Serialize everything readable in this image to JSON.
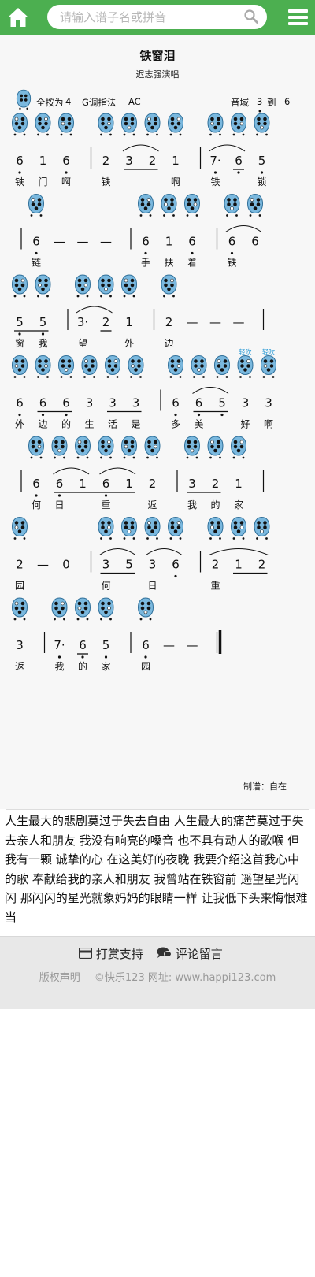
{
  "header": {
    "search_placeholder": "请输入谱子名或拼音",
    "accent_color": "#4caf50"
  },
  "song": {
    "title": "铁窗泪",
    "singer": "迟志强演唱",
    "fingering_prefix": "全按为",
    "fingering_note": "4",
    "fingering_method": "G调指法",
    "ocarina_type": "AC",
    "range_label": "音域",
    "range_low": "3",
    "range_to": "到",
    "range_high": "6",
    "maker": "制谱：自在"
  },
  "score_lines": [
    [
      {
        "n": "6",
        "lyr": "铁",
        "lo": 1,
        "oc": true
      },
      {
        "n": "1",
        "lyr": "门",
        "oc": true
      },
      {
        "n": "6",
        "lyr": "啊",
        "lo": 1,
        "oc": true
      },
      {
        "bar": true
      },
      {
        "n": "2",
        "lyr": "铁",
        "oc": true
      },
      {
        "n": "3",
        "ul": 1,
        "sl": "a",
        "oc": true
      },
      {
        "n": "2",
        "ul": 1,
        "sl": "a",
        "oc": true
      },
      {
        "n": "1",
        "lyr": "啊",
        "oc": true
      },
      {
        "bar": true
      },
      {
        "n": "7·",
        "lyr": "铁",
        "lo": 1,
        "sl": "b",
        "oc": true
      },
      {
        "n": "6",
        "ul": 1,
        "lo": 1,
        "sl": "b",
        "oc": true
      },
      {
        "n": "5",
        "lyr": "锁",
        "lo": 1,
        "oc": true
      }
    ],
    [
      {
        "bar": true
      },
      {
        "n": "6",
        "lyr": "链",
        "lo": 1,
        "oc": true
      },
      {
        "n": "—"
      },
      {
        "n": "—"
      },
      {
        "n": "—"
      },
      {
        "bar": true
      },
      {
        "n": "6",
        "lyr": "手",
        "lo": 1,
        "oc": true
      },
      {
        "n": "1",
        "lyr": "扶",
        "oc": true
      },
      {
        "n": "6",
        "lyr": "着",
        "lo": 1,
        "oc": true
      },
      {
        "bar": true
      },
      {
        "n": "6",
        "lyr": "铁",
        "lo": 1,
        "sl": "a",
        "oc": true
      },
      {
        "n": "6",
        "sl": "a",
        "oc": true
      }
    ],
    [
      {
        "n": "5",
        "ul": 1,
        "lyr": "窗",
        "lo": 1,
        "oc": true
      },
      {
        "n": "5",
        "ul": 1,
        "lyr": "我",
        "lo": 1,
        "oc": true
      },
      {
        "bar": true
      },
      {
        "n": "3·",
        "lyr": "望",
        "sl": "a",
        "oc": true
      },
      {
        "n": "2",
        "ul": 1,
        "sl": "a",
        "oc": true
      },
      {
        "n": "1",
        "lyr": "外",
        "oc": true
      },
      {
        "bar": true
      },
      {
        "n": "2",
        "lyr": "边",
        "oc": true
      },
      {
        "n": "—"
      },
      {
        "n": "—"
      },
      {
        "n": "—"
      },
      {
        "bar": true
      }
    ],
    [
      {
        "n": "6",
        "lyr": "外",
        "lo": 1,
        "oc": true
      },
      {
        "n": "6",
        "ul": 1,
        "lyr": "边",
        "lo": 1,
        "oc": true
      },
      {
        "n": "6",
        "ul": 1,
        "lyr": "的",
        "lo": 1,
        "oc": true
      },
      {
        "n": "3",
        "lyr": "生",
        "oc": true
      },
      {
        "n": "3",
        "ul": 1,
        "lyr": "活",
        "oc": true
      },
      {
        "n": "3",
        "ul": 1,
        "lyr": "是",
        "oc": true
      },
      {
        "bar": true
      },
      {
        "n": "6",
        "lyr": "多",
        "lo": 1,
        "oc": true
      },
      {
        "n": "6",
        "ul": 1,
        "lyr": "美",
        "lo": 1,
        "sl": "a",
        "oc": true
      },
      {
        "n": "5",
        "ul": 1,
        "lo": 1,
        "sl": "a",
        "oc": true
      },
      {
        "n": "3",
        "lyr": "好",
        "oc": true,
        "tag": "轻吹"
      },
      {
        "n": "3",
        "lyr": "啊",
        "oc": true,
        "tag": "轻吹"
      }
    ],
    [
      {
        "bar": true
      },
      {
        "n": "6",
        "lyr": "何",
        "lo": 1,
        "oc": true
      },
      {
        "n": "6",
        "ul": 1,
        "lyr": "日",
        "lo": 1,
        "sl": "a",
        "oc": true
      },
      {
        "n": "1",
        "ul": 1,
        "sl": "a",
        "oc": true
      },
      {
        "n": "6",
        "ul": 1,
        "lyr": "重",
        "lo": 1,
        "sl": "b",
        "oc": true
      },
      {
        "n": "1",
        "ul": 1,
        "sl": "b",
        "oc": true
      },
      {
        "n": "2",
        "lyr": "返",
        "oc": true
      },
      {
        "bar": true
      },
      {
        "n": "3",
        "ul": 1,
        "lyr": "我",
        "oc": true
      },
      {
        "n": "2",
        "ul": 1,
        "lyr": "的",
        "oc": true
      },
      {
        "n": "1",
        "lyr": "家",
        "oc": true
      },
      {
        "bar": true
      }
    ],
    [
      {
        "n": "2",
        "lyr": "园",
        "oc": true
      },
      {
        "n": "—"
      },
      {
        "n": "0"
      },
      {
        "bar": true
      },
      {
        "n": "3",
        "ul": 1,
        "lyr": "何",
        "sl": "a",
        "oc": true
      },
      {
        "n": "5",
        "ul": 1,
        "sl": "a",
        "oc": true
      },
      {
        "n": "3",
        "lyr": "日",
        "sl": "b",
        "oc": true
      },
      {
        "n": "6",
        "lo": 1,
        "sl": "b",
        "oc": true
      },
      {
        "bar": true
      },
      {
        "n": "2",
        "lyr": "重",
        "sl": "c",
        "oc": true
      },
      {
        "n": "1",
        "ul": 1,
        "sl": "c",
        "oc": true
      },
      {
        "n": "2",
        "ul": 1,
        "sl": "c",
        "oc": true
      }
    ],
    [
      {
        "n": "3",
        "lyr": "返",
        "oc": true
      },
      {
        "bar": true
      },
      {
        "n": "7·",
        "lyr": "我",
        "lo": 1,
        "oc": true
      },
      {
        "n": "6",
        "ul": 1,
        "lyr": "的",
        "lo": 1,
        "oc": true
      },
      {
        "n": "5",
        "lyr": "家",
        "lo": 1,
        "oc": true
      },
      {
        "bar": true
      },
      {
        "n": "6",
        "lyr": "园",
        "lo": 1,
        "oc": true
      },
      {
        "n": "—"
      },
      {
        "n": "—"
      },
      {
        "end": true
      }
    ]
  ],
  "description": "人生最大的悲剧莫过于失去自由 人生最大的痛苦莫过于失去亲人和朋友 我没有响亮的嗓音 也不具有动人的歌喉 但我有一颗 诚挚的心 在这美好的夜晚 我要介绍这首我心中的歌 奉献给我的亲人和朋友 我曾站在铁窗前 遥望星光闪闪 那闪闪的星光就象妈妈的眼睛一样 让我低下头来悔恨难当",
  "footer": {
    "tip_label": "打赏支持",
    "comment_label": "评论留言",
    "copyright_label": "版权声明",
    "site_text": "©快乐123 网址: www.happi123.com"
  }
}
